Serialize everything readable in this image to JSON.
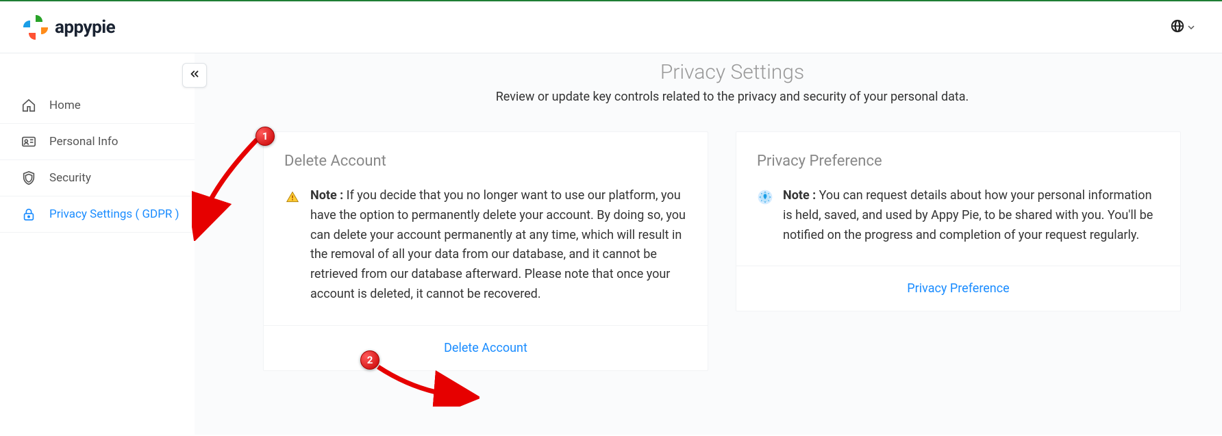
{
  "header": {
    "brand": "appypie"
  },
  "sidebar": {
    "items": [
      {
        "label": "Home"
      },
      {
        "label": "Personal Info"
      },
      {
        "label": "Security"
      },
      {
        "label": "Privacy Settings ( GDPR )"
      }
    ]
  },
  "page": {
    "title": "Privacy Settings",
    "subtitle": "Review or update key controls related to the privacy and security of your personal data."
  },
  "cards": {
    "delete": {
      "title": "Delete Account",
      "note_label": "Note :",
      "note_text": " If you decide that you no longer want to use our platform, you have the option to permanently delete your account. By doing so, you can delete your account permanently at any time, which will result in the removal of all your data from our database, and it cannot be retrieved from our database afterward. Please note that once your account is deleted, it cannot be recovered.",
      "action": "Delete Account"
    },
    "privacy": {
      "title": "Privacy Preference",
      "note_label": "Note :",
      "note_text": " You can request details about how your personal information is held, saved, and used by Appy Pie, to be shared with you. You'll be notified on the progress and completion of your request regularly.",
      "action": "Privacy Preference"
    }
  },
  "annotations": {
    "one": "1",
    "two": "2"
  }
}
